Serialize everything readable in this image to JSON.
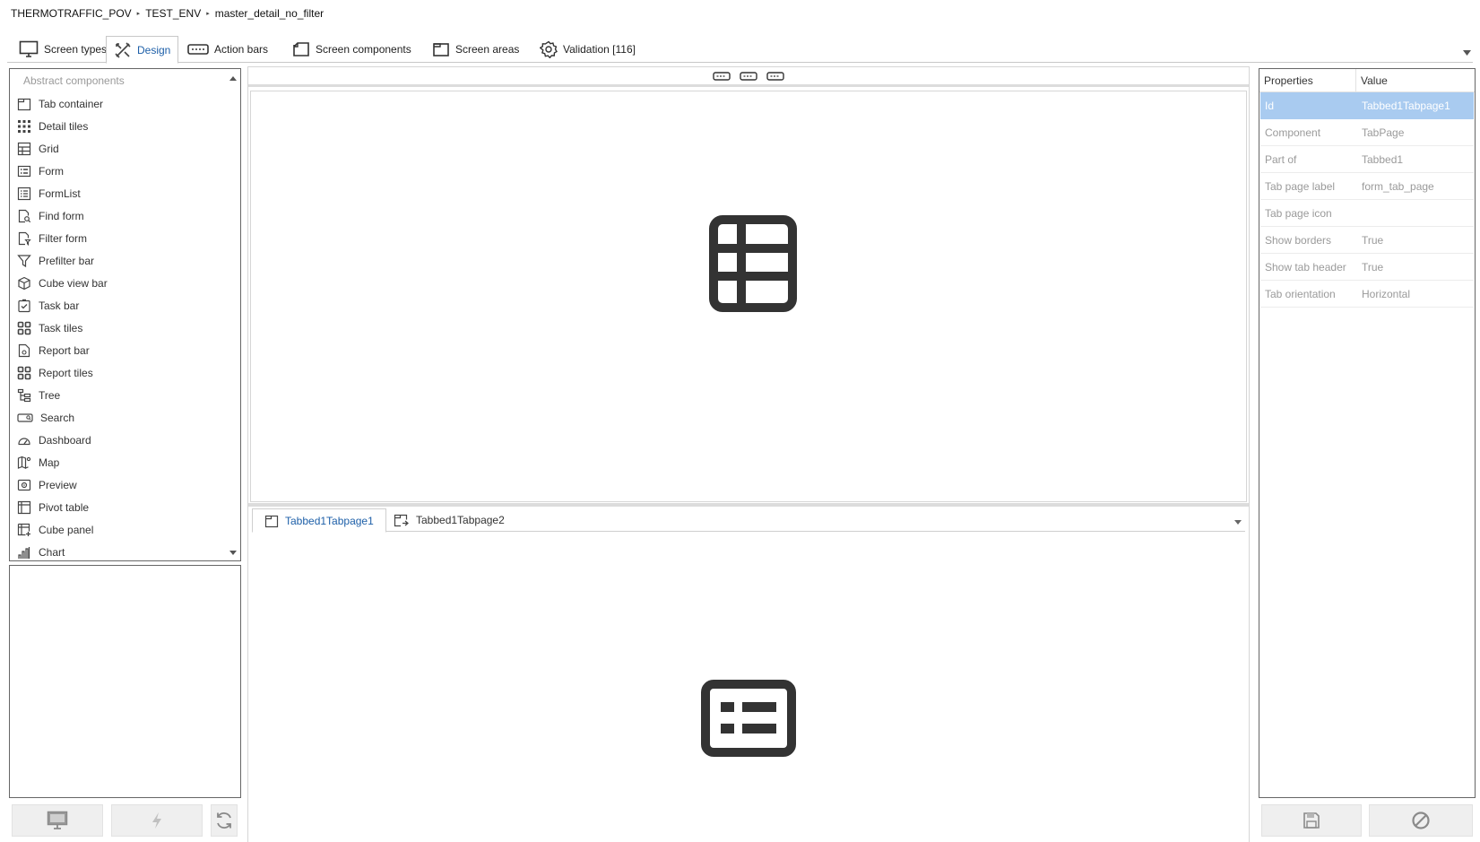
{
  "breadcrumb": {
    "items": [
      "THERMOTRAFFIC_POV",
      "TEST_ENV",
      "master_detail_no_filter"
    ],
    "separator": "▸"
  },
  "top_tabs": [
    {
      "label": "Screen types",
      "icon": "monitor-icon"
    },
    {
      "label": "Design",
      "icon": "design-tools-icon",
      "active": true
    },
    {
      "label": "Action bars",
      "icon": "action-bar-icon"
    },
    {
      "label": "Screen components",
      "icon": "screen-components-icon"
    },
    {
      "label": "Screen areas",
      "icon": "screen-areas-icon"
    },
    {
      "label": "Validation [116]",
      "icon": "validation-gear-icon"
    }
  ],
  "palette": {
    "header": "Abstract components",
    "items": [
      {
        "label": "Tab container",
        "icon": "tab-container-icon"
      },
      {
        "label": "Detail tiles",
        "icon": "detail-tiles-icon"
      },
      {
        "label": "Grid",
        "icon": "grid-icon"
      },
      {
        "label": "Form",
        "icon": "form-icon"
      },
      {
        "label": "FormList",
        "icon": "formlist-icon"
      },
      {
        "label": "Find form",
        "icon": "find-form-icon"
      },
      {
        "label": "Filter form",
        "icon": "filter-form-icon"
      },
      {
        "label": "Prefilter bar",
        "icon": "funnel-icon"
      },
      {
        "label": "Cube view bar",
        "icon": "cube-icon"
      },
      {
        "label": "Task bar",
        "icon": "task-bar-icon"
      },
      {
        "label": "Task tiles",
        "icon": "task-tiles-icon"
      },
      {
        "label": "Report bar",
        "icon": "report-bar-icon"
      },
      {
        "label": "Report tiles",
        "icon": "report-tiles-icon"
      },
      {
        "label": "Tree",
        "icon": "tree-icon"
      },
      {
        "label": "Search",
        "icon": "search-box-icon"
      },
      {
        "label": "Dashboard",
        "icon": "dashboard-gauge-icon"
      },
      {
        "label": "Map",
        "icon": "map-icon"
      },
      {
        "label": "Preview",
        "icon": "preview-icon"
      },
      {
        "label": "Pivot table",
        "icon": "pivot-table-icon"
      },
      {
        "label": "Cube panel",
        "icon": "cube-panel-icon"
      },
      {
        "label": "Chart",
        "icon": "bar-chart-icon"
      }
    ]
  },
  "canvas": {
    "tab_pages": [
      {
        "label": "Tabbed1Tabpage1",
        "icon": "tab-page-icon",
        "active": true
      },
      {
        "label": "Tabbed1Tabpage2",
        "icon": "tab-page-link-icon"
      }
    ]
  },
  "properties": {
    "header_property": "Properties",
    "header_value": "Value",
    "rows": [
      {
        "property": "Id",
        "value": "Tabbed1Tabpage1",
        "selected": true
      },
      {
        "property": "Component",
        "value": "TabPage"
      },
      {
        "property": "Part of",
        "value": "Tabbed1"
      },
      {
        "property": "Tab page label",
        "value": "form_tab_page"
      },
      {
        "property": "Tab page icon",
        "value": ""
      },
      {
        "property": "Show borders",
        "value": "True"
      },
      {
        "property": "Show tab header",
        "value": "True"
      },
      {
        "property": "Tab orientation",
        "value": "Horizontal"
      }
    ]
  },
  "colors": {
    "accent": "#1d5fa8",
    "selection": "#a9cbf0",
    "icon_dark": "#333333"
  }
}
